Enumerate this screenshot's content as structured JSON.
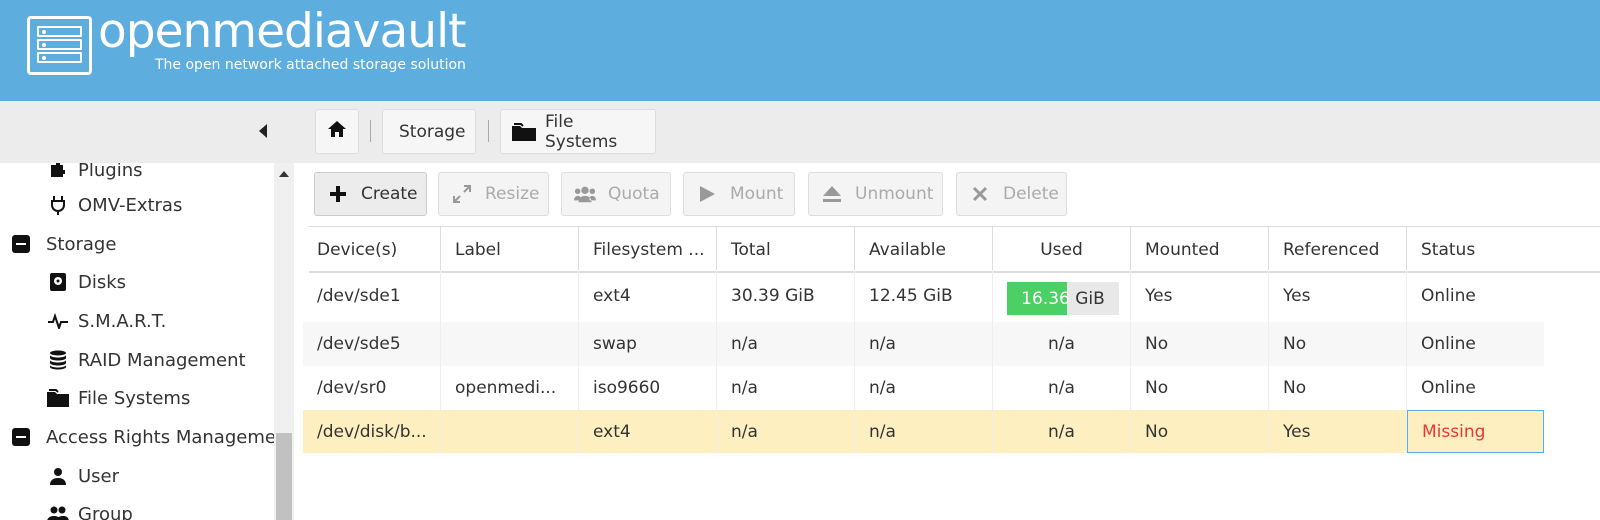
{
  "header": {
    "brand": "openmediavault",
    "tagline": "The open network attached storage solution"
  },
  "colors": {
    "header": "#5daddf",
    "used_fill": "#4cd064",
    "missing": "#e53935",
    "selected_row": "#fdefc0"
  },
  "sidebar": {
    "items": [
      {
        "label": "Plugins",
        "icon": "puzzle-icon",
        "level": 2
      },
      {
        "label": "OMV-Extras",
        "icon": "plug-icon",
        "level": 2
      },
      {
        "label": "Storage",
        "icon": "minus-box-icon",
        "level": 1
      },
      {
        "label": "Disks",
        "icon": "disk-icon",
        "level": 2
      },
      {
        "label": "S.M.A.R.T.",
        "icon": "pulse-icon",
        "level": 2
      },
      {
        "label": "RAID Management",
        "icon": "database-icon",
        "level": 2
      },
      {
        "label": "File Systems",
        "icon": "folder-icon",
        "level": 2
      },
      {
        "label": "Access Rights Management",
        "icon": "minus-box-icon",
        "level": 1
      },
      {
        "label": "User",
        "icon": "user-icon",
        "level": 2
      },
      {
        "label": "Group",
        "icon": "group-icon",
        "level": 2
      }
    ]
  },
  "breadcrumb": {
    "home_icon": "home-icon",
    "items": [
      "Storage",
      "File Systems"
    ]
  },
  "toolbar": {
    "create": "Create",
    "resize": "Resize",
    "quota": "Quota",
    "mount": "Mount",
    "unmount": "Unmount",
    "delete": "Delete"
  },
  "table": {
    "columns": [
      "Device(s)",
      "Label",
      "Filesystem ...",
      "Total",
      "Available",
      "Used",
      "Mounted",
      "Referenced",
      "Status"
    ],
    "rows": [
      {
        "device": "/dev/sde1",
        "label": "",
        "fs": "ext4",
        "total": "30.39 GiB",
        "available": "12.45 GiB",
        "used_num": "16.36",
        "used_unit": "GiB",
        "used_fraction": 0.54,
        "mounted": "Yes",
        "referenced": "Yes",
        "status": "Online"
      },
      {
        "device": "/dev/sde5",
        "label": "",
        "fs": "swap",
        "total": "n/a",
        "available": "n/a",
        "used": "n/a",
        "mounted": "No",
        "referenced": "No",
        "status": "Online"
      },
      {
        "device": "/dev/sr0",
        "label": "openmedi...",
        "fs": "iso9660",
        "total": "n/a",
        "available": "n/a",
        "used": "n/a",
        "mounted": "No",
        "referenced": "No",
        "status": "Online"
      },
      {
        "device": "/dev/disk/b...",
        "label": "",
        "fs": "ext4",
        "total": "n/a",
        "available": "n/a",
        "used": "n/a",
        "mounted": "No",
        "referenced": "Yes",
        "status": "Missing"
      }
    ]
  }
}
